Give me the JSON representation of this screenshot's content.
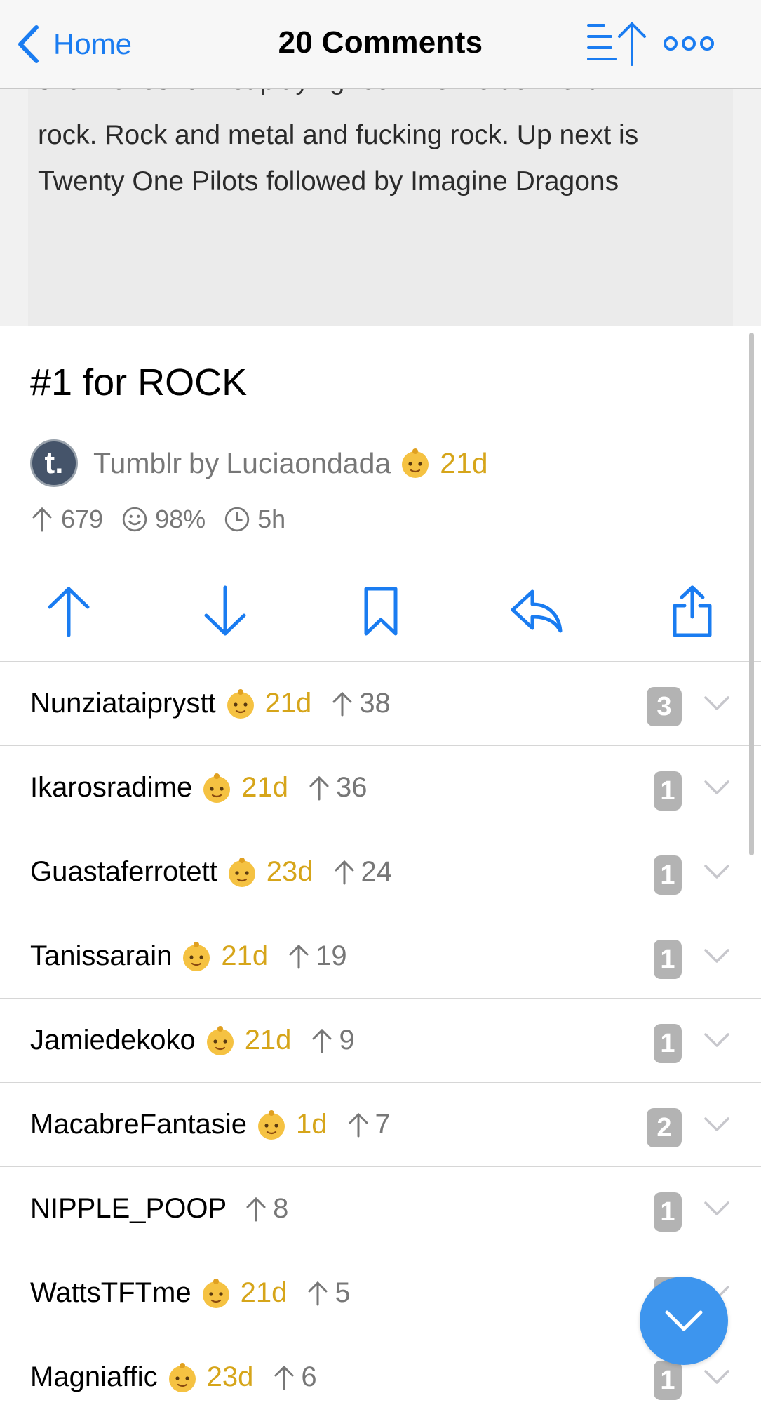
{
  "nav": {
    "back_label": "Home",
    "title": "20 Comments",
    "sort_icon": "sort-upvotes-icon",
    "more_icon": "more-dots-icon"
  },
  "post_image": {
    "cut_line": "snowflakes for not playing rock like we do. Hard",
    "text": "rock. Rock and metal and fucking rock. Up next is Twenty One Pilots followed by Imagine Dragons"
  },
  "post": {
    "title": "#1 for ROCK",
    "source": "Tumblr",
    "by_label": "by",
    "author": "Luciaondada",
    "author_age": "21d",
    "upvotes": "679",
    "ratio": "98%",
    "time": "5h"
  },
  "actions": [
    "upvote-icon",
    "downvote-icon",
    "bookmark-icon",
    "reply-icon",
    "share-icon"
  ],
  "comments": [
    {
      "user": "Nunziataiprystt",
      "age": "21d",
      "score": "38",
      "replies": "3"
    },
    {
      "user": "Ikarosradime",
      "age": "21d",
      "score": "36",
      "replies": "1"
    },
    {
      "user": "Guastaferrotett",
      "age": "23d",
      "score": "24",
      "replies": "1"
    },
    {
      "user": "Tanissarain",
      "age": "21d",
      "score": "19",
      "replies": "1"
    },
    {
      "user": "Jamiedekoko",
      "age": "21d",
      "score": "9",
      "replies": "1"
    },
    {
      "user": "MacabreFantasie",
      "age": "1d",
      "score": "7",
      "replies": "2"
    },
    {
      "user": "NIPPLE_POOP",
      "age": "",
      "score": "8",
      "replies": "1"
    },
    {
      "user": "WattsTFTme",
      "age": "21d",
      "score": "5",
      "replies": "1"
    },
    {
      "user": "Magniaffic",
      "age": "23d",
      "score": "6",
      "replies": "1"
    }
  ],
  "colors": {
    "accent": "#1a7cf1",
    "new_user_gold": "#d6a51a",
    "badge_gray": "#b3b3b3",
    "fab_blue": "#3d95ee"
  },
  "fab_icon": "chevron-down-icon"
}
